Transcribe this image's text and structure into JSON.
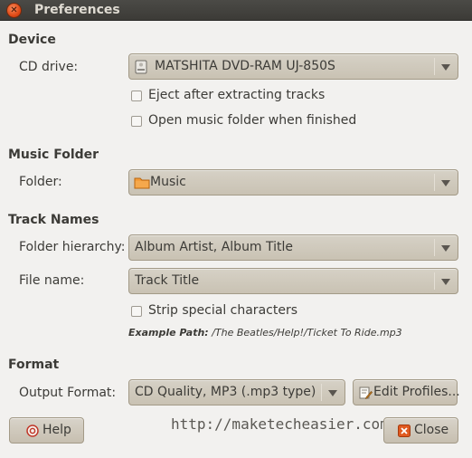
{
  "window": {
    "title": "Preferences"
  },
  "device": {
    "heading": "Device",
    "cd_drive_label": "CD drive:",
    "cd_drive_value": "MATSHITA DVD-RAM UJ-850S",
    "eject_label": "Eject after extracting tracks",
    "eject_checked": false,
    "open_folder_label": "Open music folder when finished",
    "open_folder_checked": false
  },
  "music_folder": {
    "heading": "Music Folder",
    "folder_label": "Folder:",
    "folder_value": "Music"
  },
  "track_names": {
    "heading": "Track Names",
    "hierarchy_label": "Folder hierarchy:",
    "hierarchy_value": "Album Artist, Album Title",
    "file_name_label": "File name:",
    "file_name_value": "Track Title",
    "strip_label": "Strip special characters",
    "strip_checked": false,
    "example_prefix": "Example Path:",
    "example_value": "/The Beatles/Help!/Ticket To Ride.mp3"
  },
  "format": {
    "heading": "Format",
    "output_label": "Output Format:",
    "output_value": "CD Quality, MP3 (.mp3 type)",
    "edit_profiles_label": "Edit Profiles..."
  },
  "footer": {
    "help_label": "Help",
    "close_label": "Close",
    "watermark": "http://maketecheasier.com"
  },
  "icons": {
    "window_close": "close-icon",
    "drive": "optical-drive-icon",
    "folder": "folder-icon",
    "edit": "edit-icon",
    "help": "help-icon",
    "close": "close-icon"
  },
  "colors": {
    "titlebar": "#3c3b37",
    "window_bg": "#f2f1ef",
    "close_accent": "#df4a16",
    "folder_orange": "#f08a24"
  }
}
